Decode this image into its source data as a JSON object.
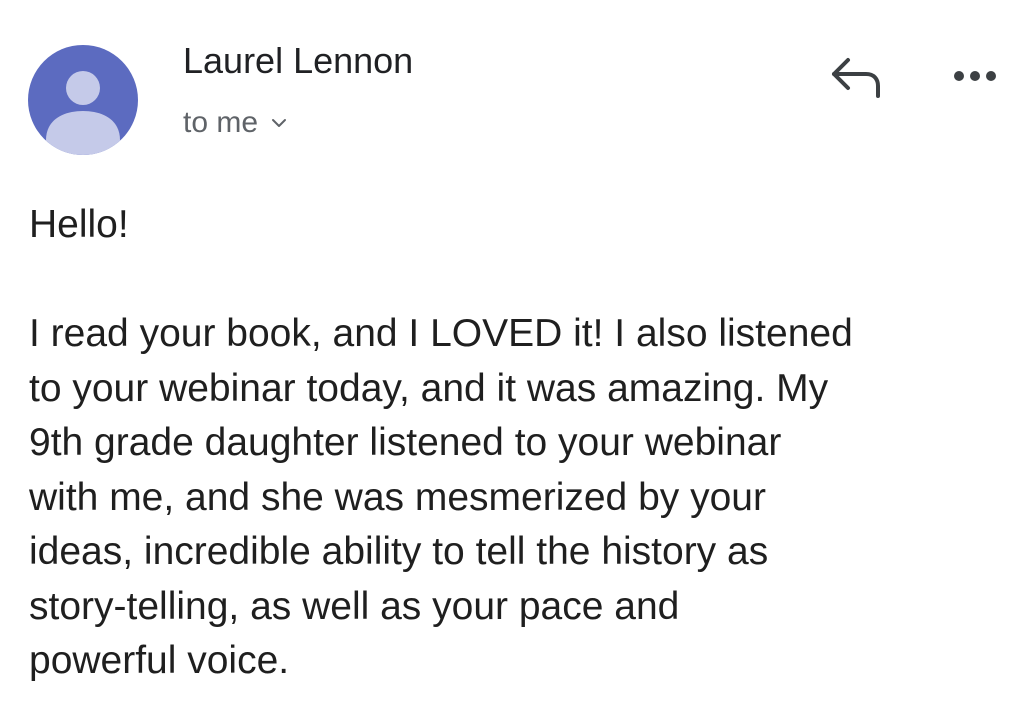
{
  "message": {
    "sender_name": "Laurel Lennon",
    "recipient_label": "to me",
    "greeting": "Hello!",
    "body_lines": [
      "I read your book, and I LOVED it! I also listened",
      "to your webinar today, and it was amazing. My",
      "9th grade daughter listened to your webinar",
      "with me, and she was mesmerized by your",
      "ideas, incredible ability to tell the history as",
      "story-telling, as well as your pace and",
      "powerful voice."
    ]
  },
  "icons": {
    "avatar": "person-avatar-icon",
    "recipient_toggle": "chevron-down-icon",
    "reply": "reply-arrow-icon",
    "more": "more-horizontal-icon"
  },
  "colors": {
    "avatar_background": "#5c6bc0",
    "avatar_figure": "#c5cae9",
    "text_primary": "#1f1f1f",
    "text_secondary": "#5f6368"
  }
}
